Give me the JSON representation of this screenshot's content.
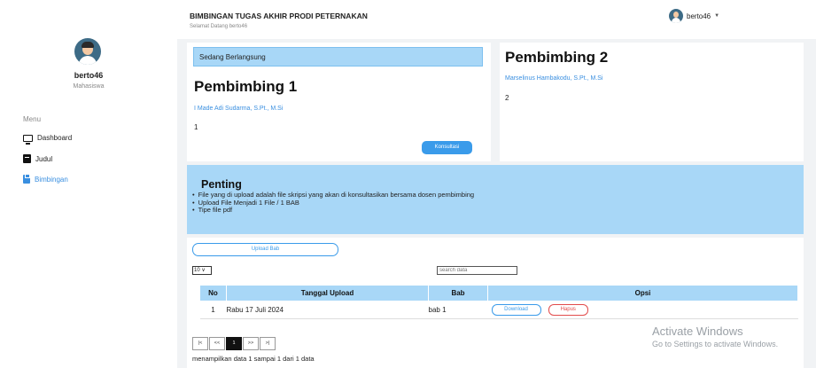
{
  "sidebar": {
    "user_name": "berto46",
    "user_role": "Mahasiswa",
    "menu_title": "Menu",
    "items": [
      {
        "label": "Dashboard",
        "icon": "monitor-icon"
      },
      {
        "label": "Judul",
        "icon": "book-icon"
      },
      {
        "label": "Bimbingan",
        "icon": "clipboard-icon",
        "active": true
      }
    ]
  },
  "header": {
    "title": "BIMBINGAN TUGAS AKHIR PRODI PETERNAKAN",
    "subtitle": "Selamat Datang berto46",
    "user": "berto46"
  },
  "pembimbing1": {
    "status": "Sedang Berlangsung",
    "title": "Pembimbing 1",
    "name": "I Made Adi Sudarma, S.Pt., M.Si",
    "count": "1",
    "button": "Konsultasi"
  },
  "pembimbing2": {
    "title": "Pembimbing 2",
    "name": "Marselinus Hambakodu, S.Pt., M.Si",
    "count": "2"
  },
  "penting": {
    "title": "Penting",
    "items": [
      "File yang di upload adalah file skripsi yang akan di konsultasikan bersama dosen pembimbing",
      "Upload File Menjadi 1 File / 1 BAB",
      "Tipe file pdf"
    ]
  },
  "table": {
    "upload_button": "Upload Bab",
    "entries": "10 ∨",
    "search_placeholder": "search data",
    "columns": [
      "No",
      "Tanggal Upload",
      "Bab",
      "Opsi"
    ],
    "rows": [
      {
        "no": "1",
        "date": "Rabu 17 Juli 2024",
        "bab": "bab 1",
        "download": "Download",
        "hapus": "Hapus"
      }
    ],
    "pager": [
      "|<",
      "<<",
      "1",
      ">>",
      ">|"
    ],
    "info": "menampilkan data 1 sampai 1 dari 1 data"
  },
  "watermark": {
    "line1": "Activate Windows",
    "line2": "Go to Settings to activate Windows."
  },
  "colors": {
    "accent": "#3a9bea",
    "light_blue": "#a8d7f7",
    "danger": "#e24b4b"
  }
}
